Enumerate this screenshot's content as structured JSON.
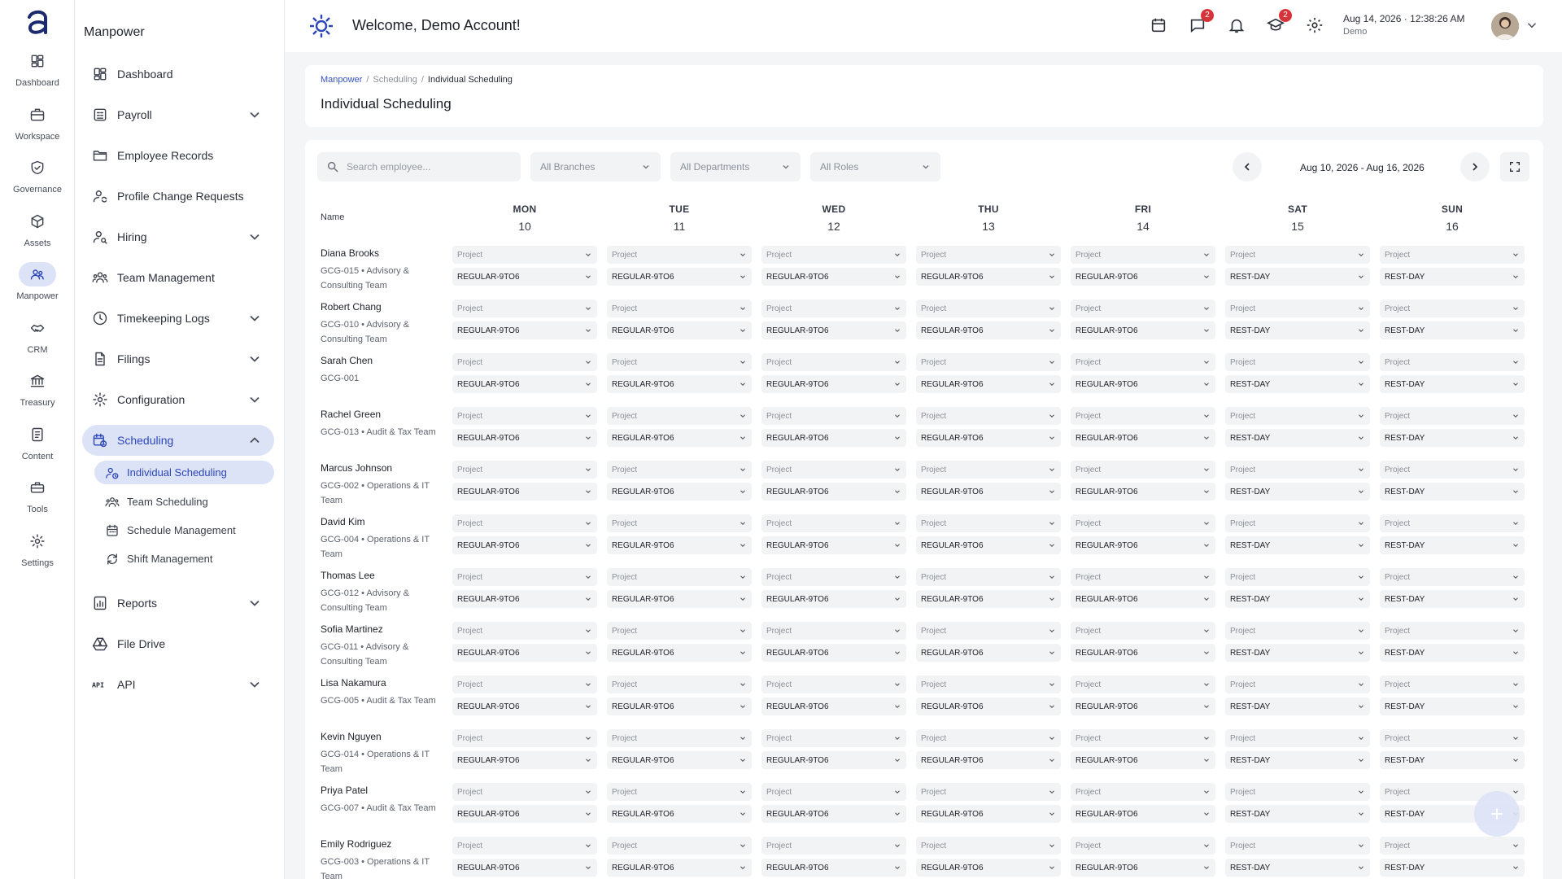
{
  "rail": {
    "items": [
      {
        "label": "Dashboard",
        "icon": "dashboard-icon"
      },
      {
        "label": "Workspace",
        "icon": "briefcase-icon"
      },
      {
        "label": "Governance",
        "icon": "shield-icon"
      },
      {
        "label": "Assets",
        "icon": "cube-icon"
      },
      {
        "label": "Manpower",
        "icon": "people-icon",
        "active": true
      },
      {
        "label": "CRM",
        "icon": "handshake-icon"
      },
      {
        "label": "Treasury",
        "icon": "bank-icon"
      },
      {
        "label": "Content",
        "icon": "document-icon"
      },
      {
        "label": "Tools",
        "icon": "toolbox-icon"
      },
      {
        "label": "Settings",
        "icon": "gear-icon"
      }
    ]
  },
  "menu": {
    "title": "Manpower",
    "items": [
      {
        "label": "Dashboard",
        "icon": "dashboard-icon",
        "expandable": false
      },
      {
        "label": "Payroll",
        "icon": "payroll-icon",
        "expandable": true
      },
      {
        "label": "Employee Records",
        "icon": "folder-icon",
        "expandable": false
      },
      {
        "label": "Profile Change Requests",
        "icon": "person-sync-icon",
        "expandable": false
      },
      {
        "label": "Hiring",
        "icon": "person-search-icon",
        "expandable": true
      },
      {
        "label": "Team Management",
        "icon": "team-icon",
        "expandable": false
      },
      {
        "label": "Timekeeping Logs",
        "icon": "clock-icon",
        "expandable": true
      },
      {
        "label": "Filings",
        "icon": "file-icon",
        "expandable": true
      },
      {
        "label": "Configuration",
        "icon": "gear-icon",
        "expandable": true
      },
      {
        "label": "Scheduling",
        "icon": "calendar-clock-icon",
        "expandable": true,
        "open": true
      },
      {
        "label": "Reports",
        "icon": "report-icon",
        "expandable": true
      },
      {
        "label": "File Drive",
        "icon": "drive-icon",
        "expandable": false
      },
      {
        "label": "API",
        "icon": "api-icon",
        "expandable": true
      }
    ],
    "scheduling_sub": [
      {
        "label": "Individual Scheduling",
        "icon": "person-clock-icon",
        "active": true
      },
      {
        "label": "Team Scheduling",
        "icon": "team-icon"
      },
      {
        "label": "Schedule Management",
        "icon": "calendar-icon"
      },
      {
        "label": "Shift Management",
        "icon": "sync-icon"
      }
    ]
  },
  "topbar": {
    "welcome": "Welcome, Demo Account!",
    "messages_badge": "2",
    "learning_badge": "2",
    "date": "Aug 14, 2026",
    "time": "12:38:26 AM",
    "user": "Demo"
  },
  "breadcrumb": {
    "root": "Manpower",
    "section": "Scheduling",
    "current": "Individual Scheduling",
    "separator": "/"
  },
  "page_title": "Individual Scheduling",
  "filters": {
    "search_placeholder": "Search employee...",
    "branches": "All Branches",
    "departments": "All Departments",
    "roles": "All Roles",
    "date_range": "Aug 10, 2026 - Aug 16, 2026"
  },
  "table": {
    "name_header": "Name",
    "project_placeholder": "Project",
    "days": [
      {
        "name": "MON",
        "date": "10"
      },
      {
        "name": "TUE",
        "date": "11"
      },
      {
        "name": "WED",
        "date": "12"
      },
      {
        "name": "THU",
        "date": "13"
      },
      {
        "name": "FRI",
        "date": "14"
      },
      {
        "name": "SAT",
        "date": "15"
      },
      {
        "name": "SUN",
        "date": "16"
      }
    ],
    "employees": [
      {
        "name": "Diana Brooks",
        "sub": "GCG-015 • Advisory & Consulting Team",
        "shifts": [
          "REGULAR-9TO6",
          "REGULAR-9TO6",
          "REGULAR-9TO6",
          "REGULAR-9TO6",
          "REGULAR-9TO6",
          "REST-DAY",
          "REST-DAY"
        ]
      },
      {
        "name": "Robert Chang",
        "sub": "GCG-010 • Advisory & Consulting Team",
        "shifts": [
          "REGULAR-9TO6",
          "REGULAR-9TO6",
          "REGULAR-9TO6",
          "REGULAR-9TO6",
          "REGULAR-9TO6",
          "REST-DAY",
          "REST-DAY"
        ]
      },
      {
        "name": "Sarah Chen",
        "sub": "GCG-001",
        "shifts": [
          "REGULAR-9TO6",
          "REGULAR-9TO6",
          "REGULAR-9TO6",
          "REGULAR-9TO6",
          "REGULAR-9TO6",
          "REST-DAY",
          "REST-DAY"
        ]
      },
      {
        "name": "Rachel Green",
        "sub": "GCG-013 • Audit & Tax Team",
        "shifts": [
          "REGULAR-9TO6",
          "REGULAR-9TO6",
          "REGULAR-9TO6",
          "REGULAR-9TO6",
          "REGULAR-9TO6",
          "REST-DAY",
          "REST-DAY"
        ]
      },
      {
        "name": "Marcus Johnson",
        "sub": "GCG-002 • Operations & IT Team",
        "shifts": [
          "REGULAR-9TO6",
          "REGULAR-9TO6",
          "REGULAR-9TO6",
          "REGULAR-9TO6",
          "REGULAR-9TO6",
          "REST-DAY",
          "REST-DAY"
        ]
      },
      {
        "name": "David Kim",
        "sub": "GCG-004 • Operations & IT Team",
        "shifts": [
          "REGULAR-9TO6",
          "REGULAR-9TO6",
          "REGULAR-9TO6",
          "REGULAR-9TO6",
          "REGULAR-9TO6",
          "REST-DAY",
          "REST-DAY"
        ]
      },
      {
        "name": "Thomas Lee",
        "sub": "GCG-012 • Advisory & Consulting Team",
        "shifts": [
          "REGULAR-9TO6",
          "REGULAR-9TO6",
          "REGULAR-9TO6",
          "REGULAR-9TO6",
          "REGULAR-9TO6",
          "REST-DAY",
          "REST-DAY"
        ]
      },
      {
        "name": "Sofia Martinez",
        "sub": "GCG-011 • Advisory & Consulting Team",
        "shifts": [
          "REGULAR-9TO6",
          "REGULAR-9TO6",
          "REGULAR-9TO6",
          "REGULAR-9TO6",
          "REGULAR-9TO6",
          "REST-DAY",
          "REST-DAY"
        ]
      },
      {
        "name": "Lisa Nakamura",
        "sub": "GCG-005 • Audit & Tax Team",
        "shifts": [
          "REGULAR-9TO6",
          "REGULAR-9TO6",
          "REGULAR-9TO6",
          "REGULAR-9TO6",
          "REGULAR-9TO6",
          "REST-DAY",
          "REST-DAY"
        ]
      },
      {
        "name": "Kevin Nguyen",
        "sub": "GCG-014 • Operations & IT Team",
        "shifts": [
          "REGULAR-9TO6",
          "REGULAR-9TO6",
          "REGULAR-9TO6",
          "REGULAR-9TO6",
          "REGULAR-9TO6",
          "REST-DAY",
          "REST-DAY"
        ]
      },
      {
        "name": "Priya Patel",
        "sub": "GCG-007 • Audit & Tax Team",
        "shifts": [
          "REGULAR-9TO6",
          "REGULAR-9TO6",
          "REGULAR-9TO6",
          "REGULAR-9TO6",
          "REGULAR-9TO6",
          "REST-DAY",
          "REST-DAY"
        ]
      },
      {
        "name": "Emily Rodriguez",
        "sub": "GCG-003 • Operations & IT Team",
        "shifts": [
          "REGULAR-9TO6",
          "REGULAR-9TO6",
          "REGULAR-9TO6",
          "REGULAR-9TO6",
          "REGULAR-9TO6",
          "REST-DAY",
          "REST-DAY"
        ]
      }
    ]
  },
  "colors": {
    "accent": "#2c46b8",
    "active_bg": "#dde3f7",
    "badge": "#d6343a",
    "field_bg": "#f2f3f5"
  }
}
